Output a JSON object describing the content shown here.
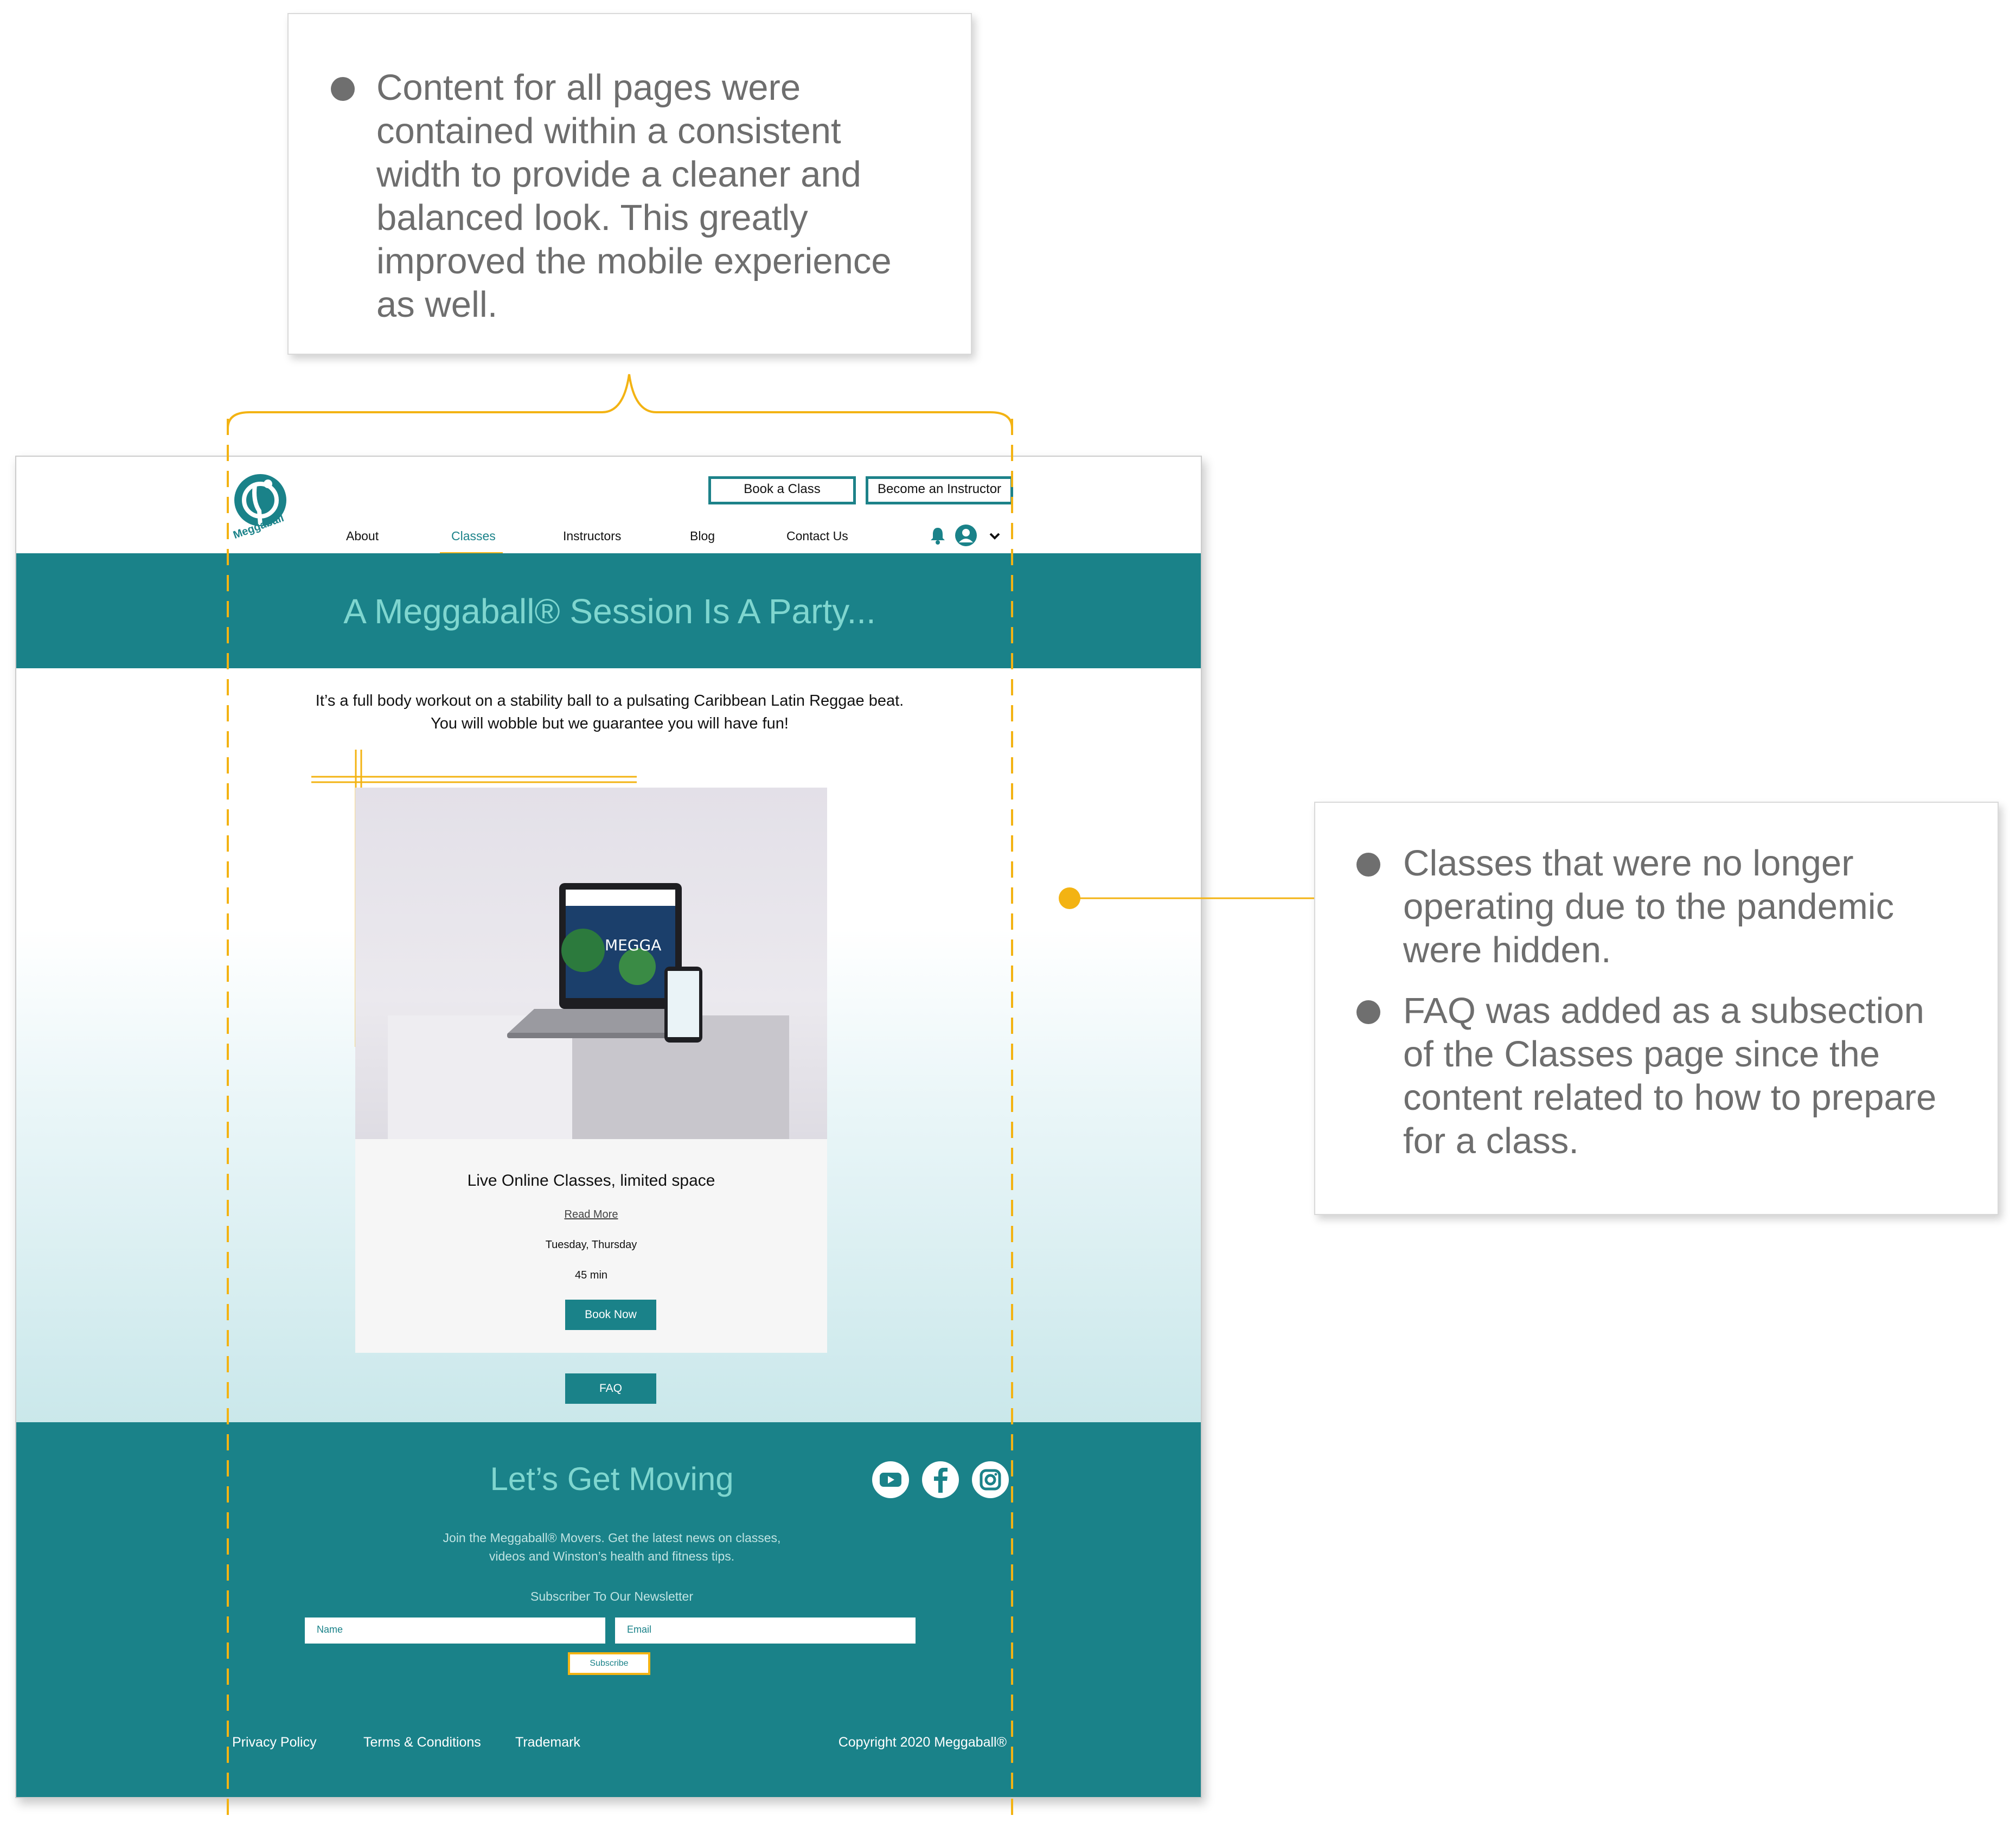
{
  "callouts": {
    "top": {
      "bullets": [
        "Content for all pages were contained within a consistent width to provide a cleaner and balanced look. This greatly improved the mobile experience as well."
      ]
    },
    "right": {
      "bullets": [
        "Classes that were no longer operating due to the pandemic were hidden.",
        "FAQ was added as a subsection of the Classes page since the content related to how to prepare for a class."
      ]
    }
  },
  "site": {
    "logo_text": "Meggaball",
    "header": {
      "book_class": "Book a Class",
      "become_instructor": "Become an Instructor"
    },
    "nav": {
      "items": [
        "About",
        "Classes",
        "Instructors",
        "Blog",
        "Contact Us"
      ],
      "active": "Classes"
    },
    "hero": {
      "title": "A Meggaball® Session Is A Party..."
    },
    "intro": {
      "line1": "It’s a full body workout on a stability ball to a pulsating Caribbean Latin Reggae beat.",
      "line2": "You will wobble but we guarantee you will have fun!"
    },
    "class_card": {
      "title": "Live Online Classes, limited space",
      "read_more": "Read More",
      "days": "Tuesday, Thursday",
      "duration": "45 min",
      "book_now": "Book Now",
      "device_brand": "MEGGA"
    },
    "faq_button": "FAQ",
    "footer": {
      "title": "Let’s Get Moving",
      "desc_line1": "Join the Meggaball® Movers. Get the latest news on classes,",
      "desc_line2": "videos and Winston’s health and fitness tips.",
      "newsletter_label": "Subscriber To Our Newsletter",
      "name_placeholder": "Name",
      "email_placeholder": "Email",
      "subscribe": "Subscribe",
      "links": [
        "Privacy Policy",
        "Terms & Conditions",
        "Trademark"
      ],
      "copyright": "Copyright 2020 Meggaball®"
    }
  },
  "colors": {
    "teal": "#1a8289",
    "hero_title": "#7fd6cf",
    "accent_yellow": "#f3b313",
    "callout_text": "#6e6e6e"
  }
}
